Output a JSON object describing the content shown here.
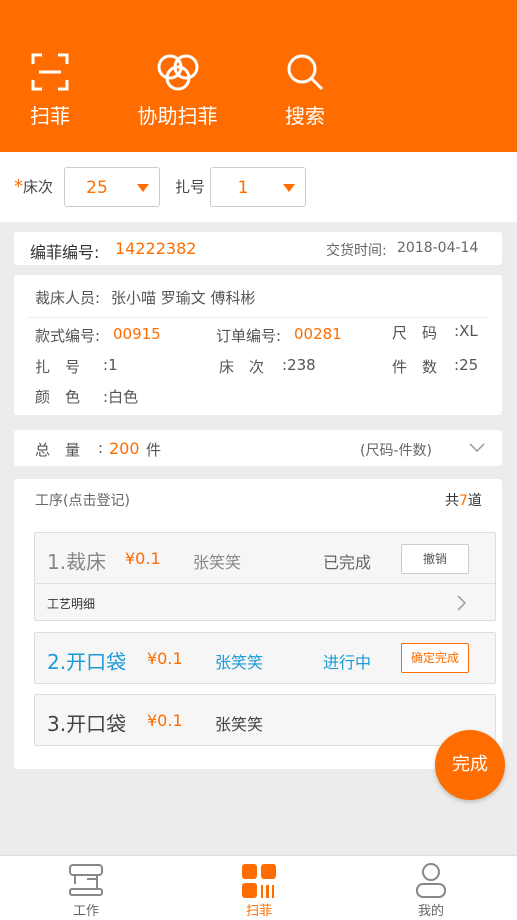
{
  "header": {
    "scan_label": "扫菲",
    "assist_label": "协助扫菲",
    "search_label": "搜索"
  },
  "filter": {
    "bed_label": "床次",
    "bed_value": "25",
    "bundle_label": "扎号",
    "bundle_value": "1"
  },
  "ticket": {
    "code_label": "编菲编号:",
    "code_value": "14222382",
    "delivery_label": "交货时间:",
    "delivery_value": "2018-04-14"
  },
  "info": {
    "cutters_label": "裁床人员:",
    "cutters": "张小喵  罗瑜文  傅科彬",
    "style_label": "款式编号:",
    "style_value": "00915",
    "order_label": "订单编号:",
    "order_value": "00281",
    "size_label": "尺　码",
    "size_value": "XL",
    "bundle_label": "扎　号",
    "bundle_value": "1",
    "bed_label": "床　次",
    "bed_value": "238",
    "pieces_label": "件　数",
    "pieces_value": "25",
    "color_label": "颜　色",
    "color_value": "白色"
  },
  "total": {
    "label": "总　量",
    "value": "200",
    "unit": "件",
    "hint": "(尺码-件数)"
  },
  "process": {
    "title": "工序(点击登记)",
    "count_prefix": "共",
    "count": "7",
    "count_suffix": "道",
    "items": [
      {
        "name": "1.裁床",
        "price": "¥0.1",
        "worker": "张笑笑",
        "status": "已完成",
        "action": "撤销",
        "detail": "工艺明细"
      },
      {
        "name": "2.开口袋",
        "price": "¥0.1",
        "worker": "张笑笑",
        "status": "进行中",
        "action": "确定完成"
      },
      {
        "name": "3.开口袋",
        "price": "¥0.1",
        "worker": "张笑笑"
      }
    ]
  },
  "fab_label": "完成",
  "bottom_nav": [
    {
      "label": "工作"
    },
    {
      "label": "扫菲"
    },
    {
      "label": "我的"
    }
  ],
  "colors": {
    "accent": "#ff6c00",
    "blue": "#1a9ad6"
  }
}
